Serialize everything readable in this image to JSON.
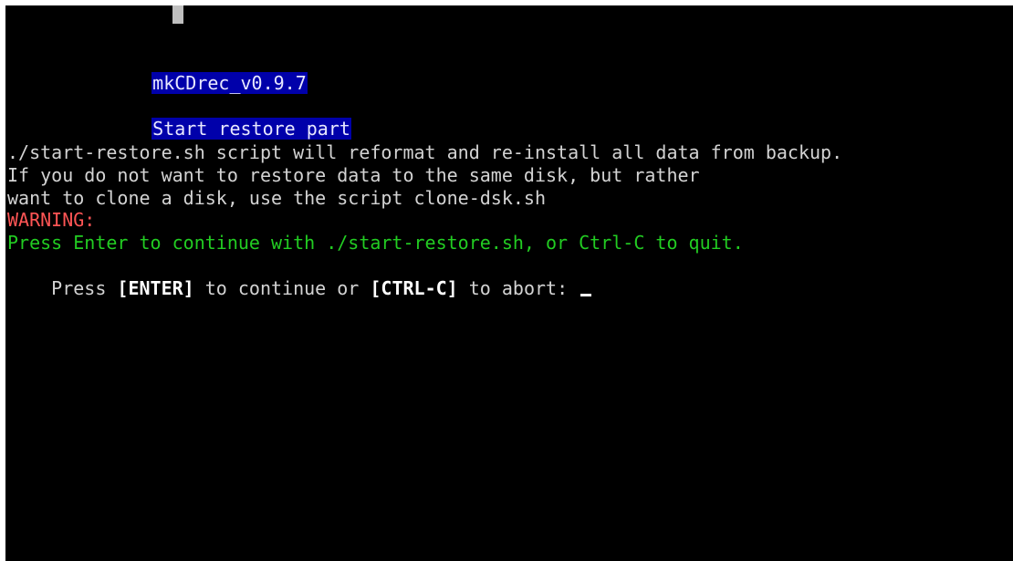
{
  "terminal": {
    "title_label": "mkCDrec_v0.9.7",
    "subtitle_label": "Start restore part",
    "info_lines": [
      "./start-restore.sh script will reformat and re-install all data from backup.",
      "If you do not want to restore data to the same disk, but rather",
      "want to clone a disk, use the script clone-dsk.sh"
    ],
    "warning_label": "WARNING:",
    "continue_message": "Press Enter to continue with ./start-restore.sh, or Ctrl-C to quit.",
    "prompt": {
      "prefix": "Press ",
      "enter_key": "[ENTER]",
      "middle": " to continue or ",
      "ctrl_c_key": "[CTRL-C]",
      "suffix": " to abort: "
    }
  },
  "colors": {
    "background": "#000000",
    "text": "#d3d3d3",
    "highlight": "#0000aa",
    "warning": "#ff5555",
    "success": "#22cc22"
  }
}
